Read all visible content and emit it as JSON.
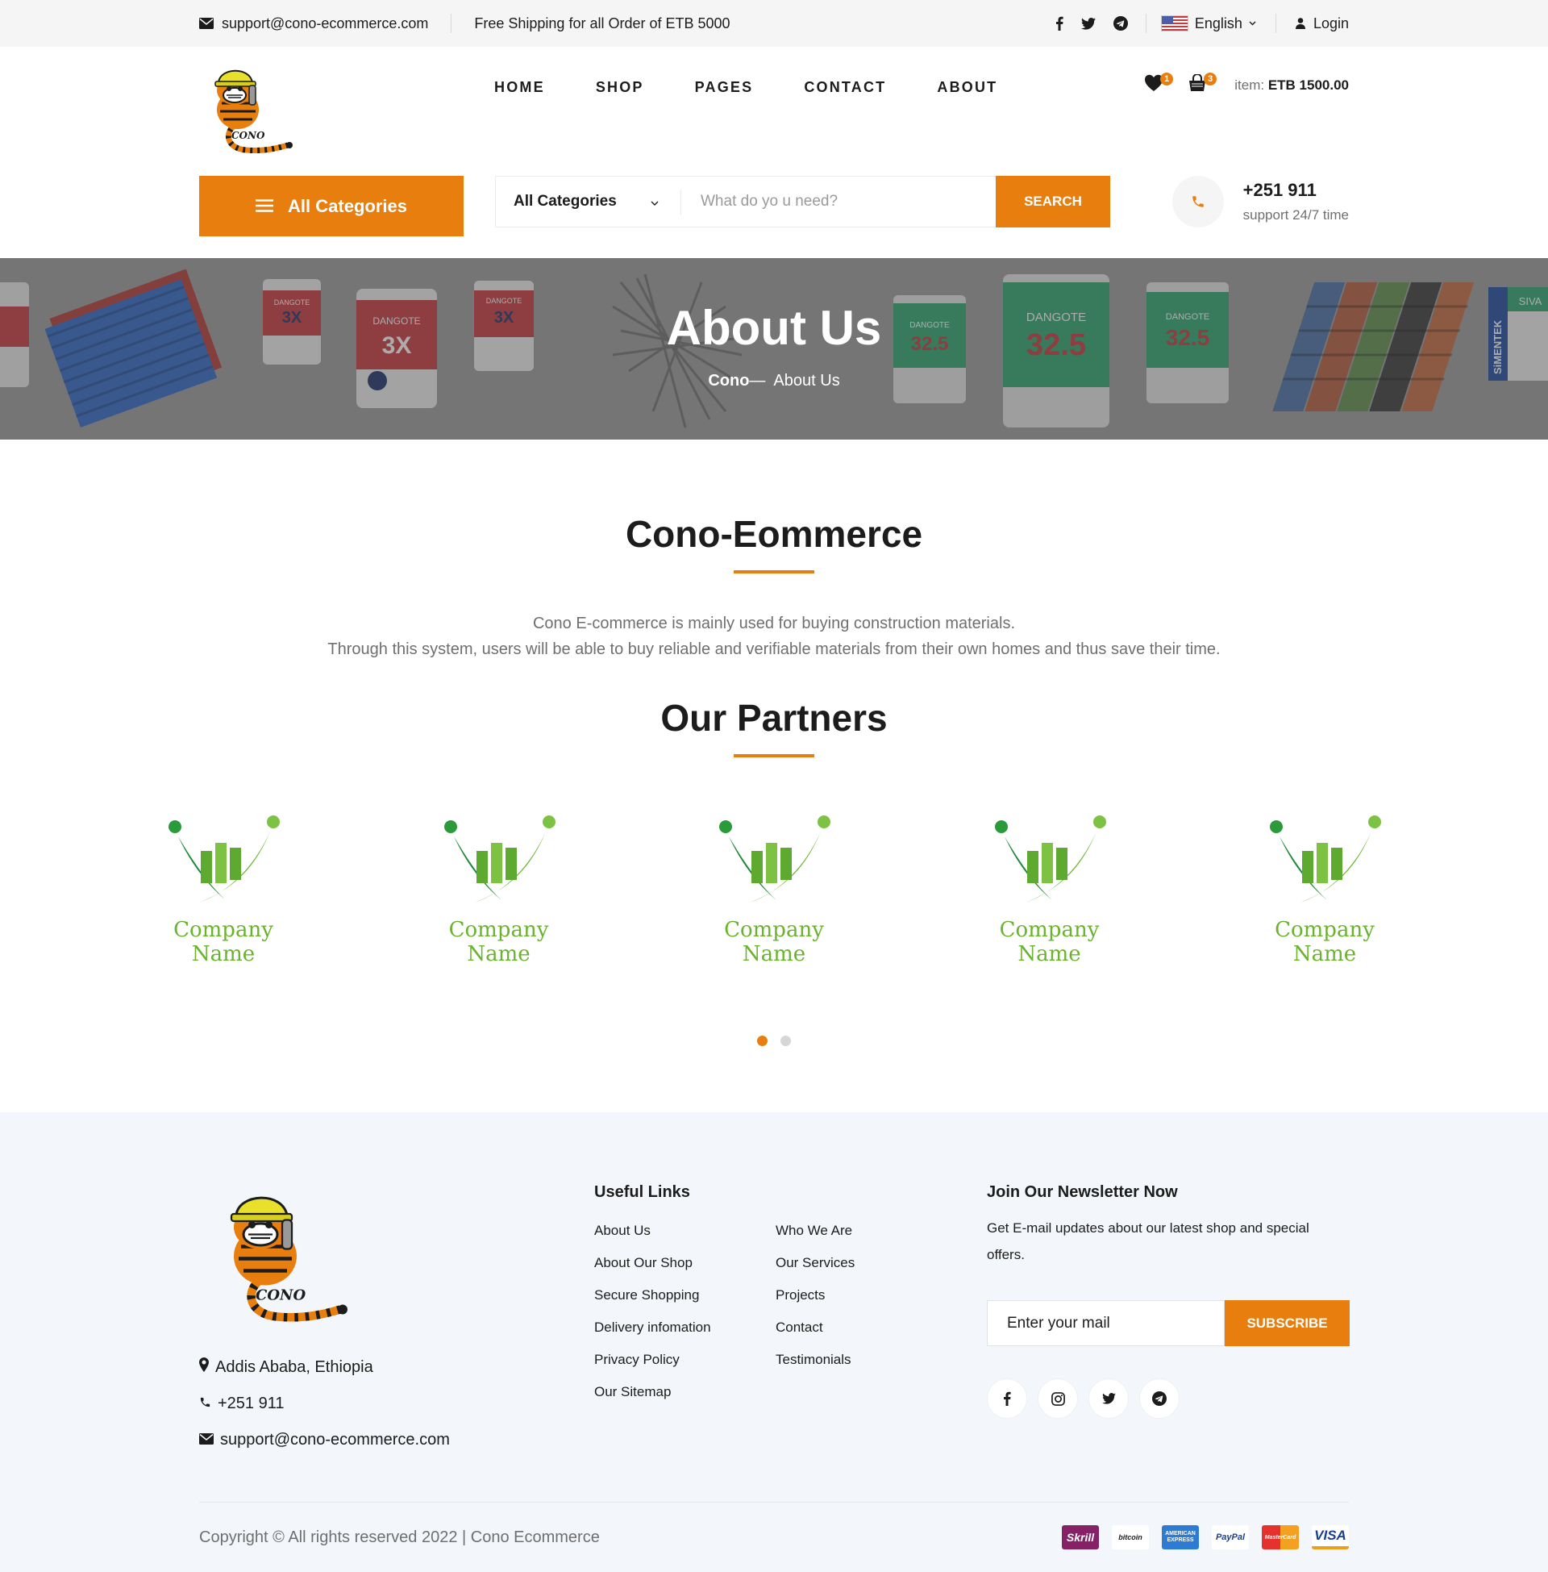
{
  "topbar": {
    "email": "support@cono-ecommerce.com",
    "shipping": "Free Shipping for all Order of ETB 5000",
    "language": "English",
    "login": "Login"
  },
  "header": {
    "logo_text": "CONO",
    "nav": [
      "HOME",
      "SHOP",
      "PAGES",
      "CONTACT",
      "ABOUT"
    ],
    "wishlist_count": "1",
    "cart_count": "3",
    "cart_label": "item:",
    "cart_total": "ETB 1500.00"
  },
  "search": {
    "all_categories": "All Categories",
    "category_select": "All Categories",
    "placeholder": "What do yo u need?",
    "button": "SEARCH",
    "phone": "+251 911",
    "support": "support 24/7 time"
  },
  "hero": {
    "title": "About Us",
    "breadcrumb_home": "Cono",
    "breadcrumb_sep": "—",
    "breadcrumb_current": "About Us",
    "product_labels": [
      "DANGOTE",
      "3X",
      "32.5",
      "SiMENTEK",
      "SIVA"
    ]
  },
  "about": {
    "title": "Cono-Eommerce",
    "line1": "Cono E-commerce is mainly used for buying construction materials.",
    "line2": "Through this system, users will be able to buy reliable and verifiable materials from their own homes and thus save their time."
  },
  "partners": {
    "title": "Our Partners",
    "items": [
      "Company Name",
      "Company Name",
      "Company Name",
      "Company Name",
      "Company Name"
    ]
  },
  "footer": {
    "logo_text": "CONO",
    "address": "Addis Ababa, Ethiopia",
    "phone": "+251 911",
    "email": "support@cono-ecommerce.com",
    "useful_links_title": "Useful Links",
    "links_col1": [
      "About Us",
      "About Our Shop",
      "Secure Shopping",
      "Delivery infomation",
      "Privacy Policy",
      "Our Sitemap"
    ],
    "links_col2": [
      "Who We Are",
      "Our Services",
      "Projects",
      "Contact",
      "Testimonials"
    ],
    "newsletter_title": "Join Our Newsletter Now",
    "newsletter_text": "Get E-mail updates about our latest shop and special offers.",
    "newsletter_placeholder": "Enter your mail",
    "subscribe": "SUBSCRIBE",
    "copyright": "Copyright © All rights reserved 2022 | Cono Ecommerce",
    "payments": [
      "Skrill",
      "bitcoin",
      "AMERICAN EXPRESS",
      "PayPal",
      "MasterCard",
      "VISA"
    ]
  },
  "colors": {
    "accent": "#e77e0d",
    "partner_green": "#6bb32e",
    "footer_bg": "#f3f6fa"
  }
}
